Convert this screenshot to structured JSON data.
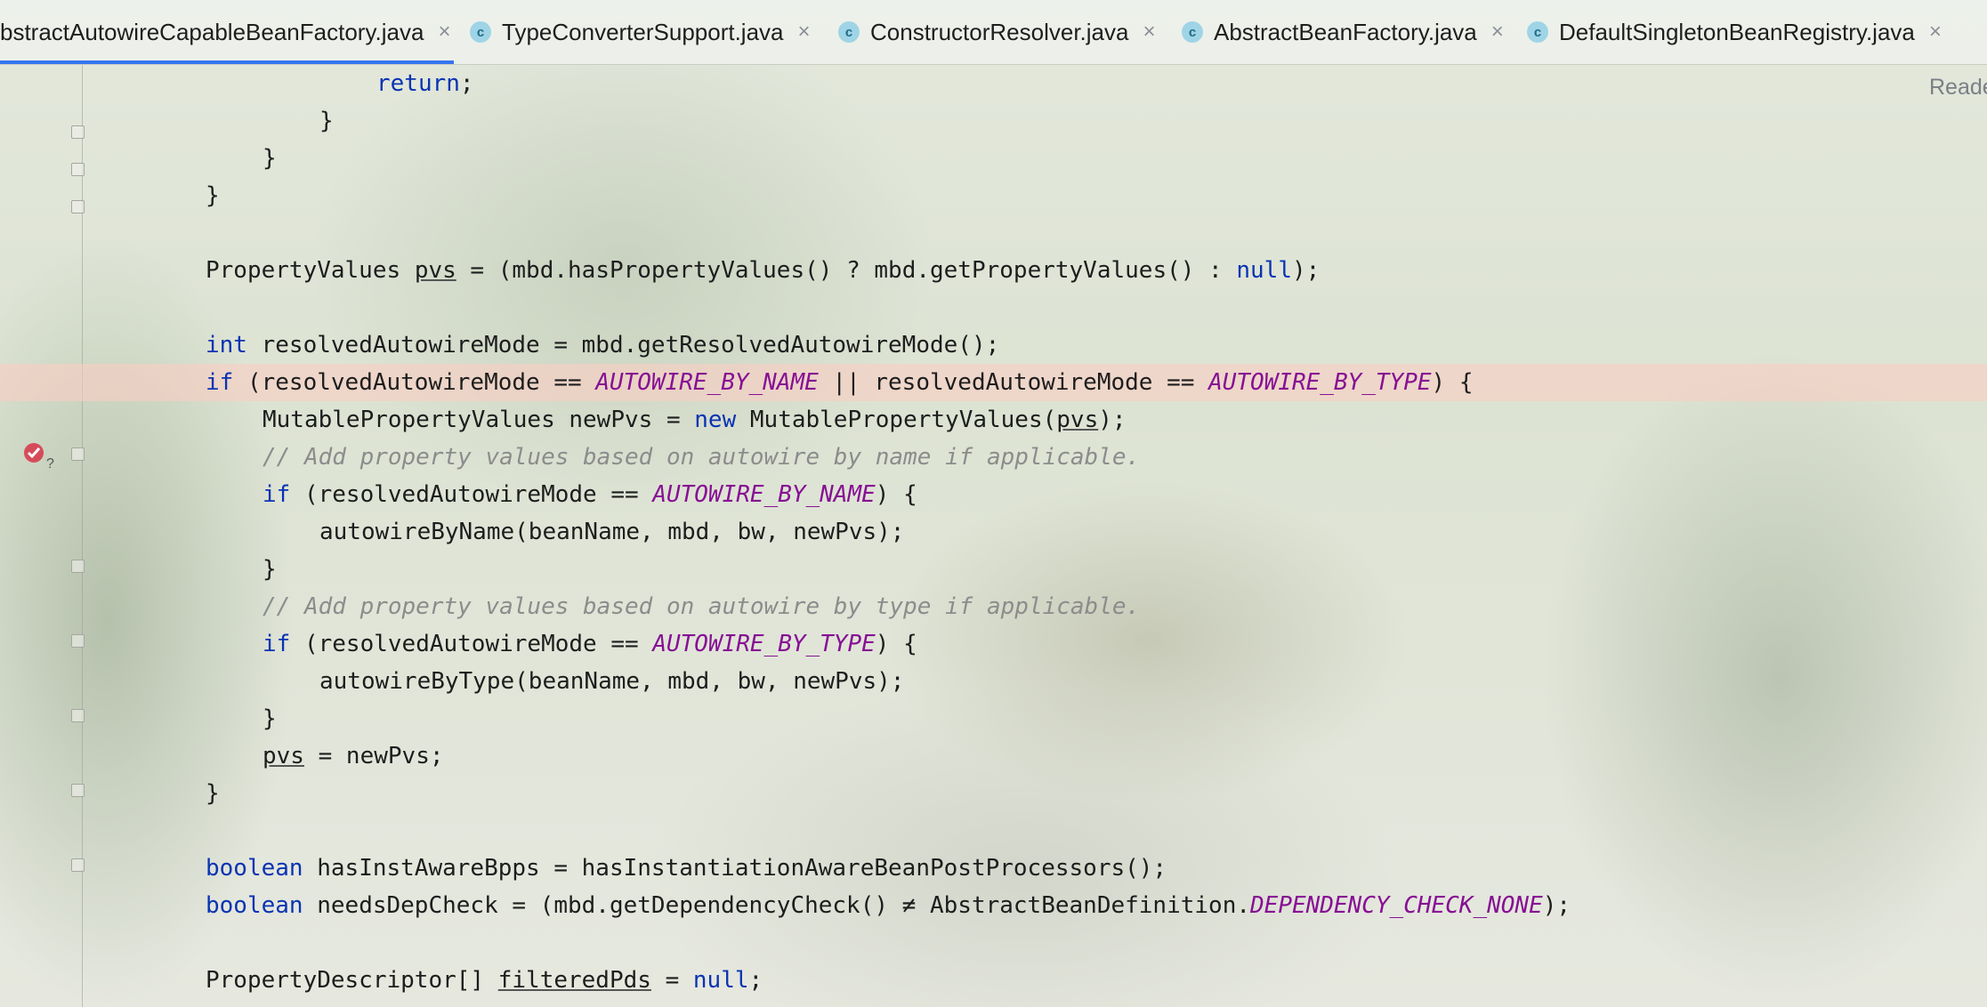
{
  "tabs": [
    {
      "label": "bstractAutowireCapableBeanFactory.java",
      "active": true,
      "has_icon": false
    },
    {
      "label": "TypeConverterSupport.java",
      "active": false,
      "has_icon": true
    },
    {
      "label": "ConstructorResolver.java",
      "active": false,
      "has_icon": true
    },
    {
      "label": "AbstractBeanFactory.java",
      "active": false,
      "has_icon": true
    },
    {
      "label": "DefaultSingletonBeanRegistry.java",
      "active": false,
      "has_icon": true
    }
  ],
  "tab_close_glyph": "×",
  "class_icon_letter": "c",
  "right_label": "Reade",
  "highlighted_line_index": 8,
  "code_lines": [
    {
      "indent": 6,
      "segments": [
        [
          "kw",
          "return"
        ],
        [
          "n",
          ";"
        ]
      ]
    },
    {
      "indent": 5,
      "segments": [
        [
          "n",
          "}"
        ]
      ]
    },
    {
      "indent": 4,
      "segments": [
        [
          "n",
          "}"
        ]
      ]
    },
    {
      "indent": 3,
      "segments": [
        [
          "n",
          "}"
        ]
      ]
    },
    {
      "indent": 3,
      "segments": []
    },
    {
      "indent": 3,
      "segments": [
        [
          "n",
          "PropertyValues "
        ],
        [
          "u",
          "pvs"
        ],
        [
          "n",
          " = (mbd.hasPropertyValues() ? mbd.getPropertyValues() : "
        ],
        [
          "kw",
          "null"
        ],
        [
          "n",
          ");"
        ]
      ]
    },
    {
      "indent": 3,
      "segments": []
    },
    {
      "indent": 3,
      "segments": [
        [
          "kw",
          "int"
        ],
        [
          "n",
          " resolvedAutowireMode = mbd.getResolvedAutowireMode();"
        ]
      ]
    },
    {
      "indent": 3,
      "segments": [
        [
          "kw",
          "if"
        ],
        [
          "n",
          " (resolvedAutowireMode == "
        ],
        [
          "const",
          "AUTOWIRE_BY_NAME"
        ],
        [
          "n",
          " || resolvedAutowireMode == "
        ],
        [
          "const",
          "AUTOWIRE_BY_TYPE"
        ],
        [
          "n",
          ") {"
        ]
      ]
    },
    {
      "indent": 4,
      "segments": [
        [
          "n",
          "MutablePropertyValues newPvs = "
        ],
        [
          "kw",
          "new"
        ],
        [
          "n",
          " MutablePropertyValues("
        ],
        [
          "u",
          "pvs"
        ],
        [
          "n",
          ");"
        ]
      ]
    },
    {
      "indent": 4,
      "segments": [
        [
          "cmt",
          "// Add property values based on autowire by name if applicable."
        ]
      ]
    },
    {
      "indent": 4,
      "segments": [
        [
          "kw",
          "if"
        ],
        [
          "n",
          " (resolvedAutowireMode == "
        ],
        [
          "const",
          "AUTOWIRE_BY_NAME"
        ],
        [
          "n",
          ") {"
        ]
      ]
    },
    {
      "indent": 5,
      "segments": [
        [
          "n",
          "autowireByName(beanName, mbd, bw, newPvs);"
        ]
      ]
    },
    {
      "indent": 4,
      "segments": [
        [
          "n",
          "}"
        ]
      ]
    },
    {
      "indent": 4,
      "segments": [
        [
          "cmt",
          "// Add property values based on autowire by type if applicable."
        ]
      ]
    },
    {
      "indent": 4,
      "segments": [
        [
          "kw",
          "if"
        ],
        [
          "n",
          " (resolvedAutowireMode == "
        ],
        [
          "const",
          "AUTOWIRE_BY_TYPE"
        ],
        [
          "n",
          ") {"
        ]
      ]
    },
    {
      "indent": 5,
      "segments": [
        [
          "n",
          "autowireByType(beanName, mbd, bw, newPvs);"
        ]
      ]
    },
    {
      "indent": 4,
      "segments": [
        [
          "n",
          "}"
        ]
      ]
    },
    {
      "indent": 4,
      "segments": [
        [
          "u",
          "pvs"
        ],
        [
          "n",
          " = newPvs;"
        ]
      ]
    },
    {
      "indent": 3,
      "segments": [
        [
          "n",
          "}"
        ]
      ]
    },
    {
      "indent": 3,
      "segments": []
    },
    {
      "indent": 3,
      "segments": [
        [
          "kw",
          "boolean"
        ],
        [
          "n",
          " hasInstAwareBpps = hasInstantiationAwareBeanPostProcessors();"
        ]
      ]
    },
    {
      "indent": 3,
      "segments": [
        [
          "kw",
          "boolean"
        ],
        [
          "n",
          " needsDepCheck = (mbd.getDependencyCheck() ≠ AbstractBeanDefinition."
        ],
        [
          "const",
          "DEPENDENCY_CHECK_NONE"
        ],
        [
          "n",
          ");"
        ]
      ]
    },
    {
      "indent": 3,
      "segments": []
    },
    {
      "indent": 3,
      "segments": [
        [
          "n",
          "PropertyDescriptor[] "
        ],
        [
          "u",
          "filteredPds"
        ],
        [
          "n",
          " = "
        ],
        [
          "kw",
          "null"
        ],
        [
          "n",
          ";"
        ]
      ]
    }
  ]
}
